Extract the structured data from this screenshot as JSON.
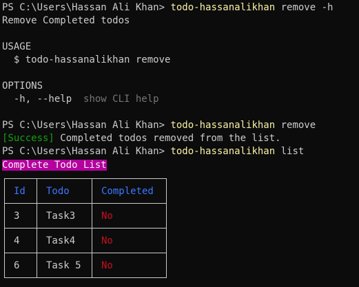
{
  "lines": {
    "l1_prompt": "PS C:\\Users\\Hassan Ali Khan> ",
    "l1_cmd": "todo-hassanalikhan",
    "l1_args": " remove -h",
    "l2": "Remove Completed todos",
    "l4": "USAGE",
    "l5": "  $ todo-hassanalikhan remove",
    "l7": "OPTIONS",
    "l8_flag": "  -h, --help",
    "l8_desc": "  show CLI help",
    "l10_prompt": "PS C:\\Users\\Hassan Ali Khan> ",
    "l10_cmd": "todo-hassanalikhan",
    "l10_args": " remove",
    "l11_tag": "[Success]",
    "l11_msg": " Completed todos removed from the list.",
    "l12_prompt": "PS C:\\Users\\Hassan Ali Khan> ",
    "l12_cmd": "todo-hassanalikhan",
    "l12_args": " list",
    "l13_banner": "Complete Todo List"
  },
  "table": {
    "headers": {
      "id": "Id",
      "todo": "Todo",
      "completed": "Completed"
    },
    "rows": [
      {
        "id": "3",
        "todo": "Task3",
        "completed": "No"
      },
      {
        "id": "4",
        "todo": "Task4",
        "completed": "No"
      },
      {
        "id": "6",
        "todo": "Task 5",
        "completed": "No"
      }
    ]
  },
  "colors": {
    "background": "#0c0c0c",
    "text": "#cccccc",
    "command": "#f9f1a5",
    "success": "#13a10e",
    "highlight": "#b4009e",
    "header": "#3b78ff",
    "no": "#c50f1f"
  }
}
